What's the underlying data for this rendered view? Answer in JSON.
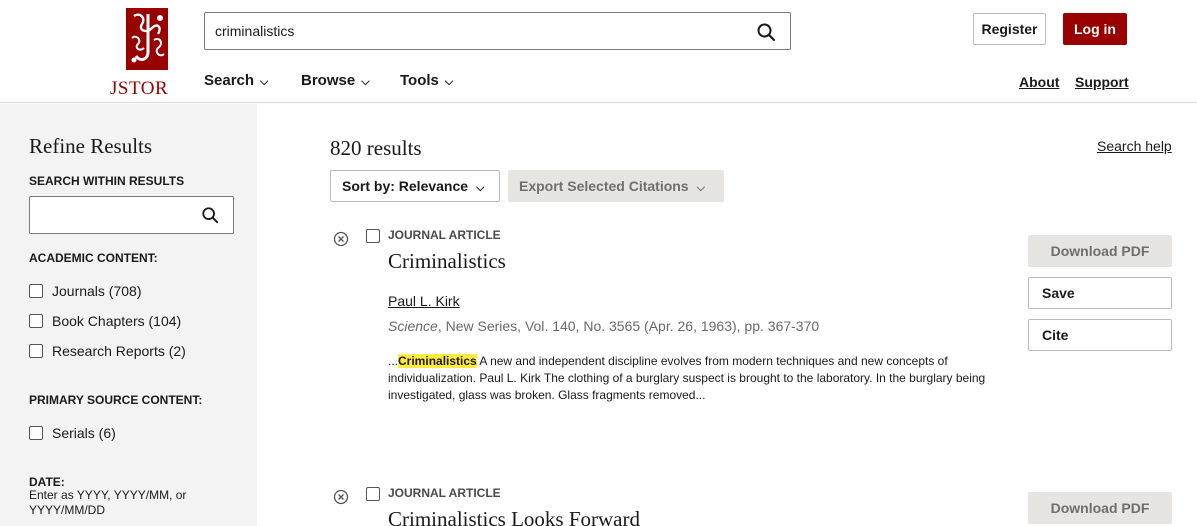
{
  "brand": {
    "name": "JSTOR",
    "color": "#990000"
  },
  "search": {
    "query": "criminalistics",
    "icon": "search-icon"
  },
  "nav": {
    "search": "Search",
    "browse": "Browse",
    "tools": "Tools"
  },
  "account": {
    "register": "Register",
    "login": "Log in"
  },
  "links": {
    "about": "About",
    "support": "Support"
  },
  "sidebar": {
    "title": "Refine Results",
    "within_label": "SEARCH WITHIN RESULTS",
    "within_value": "",
    "academic_label": "ACADEMIC CONTENT:",
    "academic_items": [
      {
        "label": "Journals (708)"
      },
      {
        "label": "Book Chapters (104)"
      },
      {
        "label": "Research Reports (2)"
      }
    ],
    "primary_label": "PRIMARY SOURCE CONTENT:",
    "primary_items": [
      {
        "label": "Serials (6)"
      }
    ],
    "date_label": "DATE:",
    "date_hint": "Enter as YYYY, YYYY/MM, or YYYY/MM/DD"
  },
  "results": {
    "count": "820 results",
    "help": "Search help",
    "sort": "Sort by: Relevance",
    "export": "Export Selected Citations",
    "items": [
      {
        "type": "JOURNAL ARTICLE",
        "title": "Criminalistics",
        "author": "Paul L. Kirk",
        "journal": "Science",
        "source_rest": ", New Series, Vol. 140, No. 3565 (Apr. 26, 1963), pp. 367-370",
        "snippet_pre": "...",
        "snippet_hl": "Criminalistics",
        "snippet_post": " A new and independent discipline evolves from modern techniques and new concepts of individualization. Paul L. Kirk The clothing of a burglary suspect is brought to the laboratory. In the burglary being investigated, glass was broken. Glass fragments removed...",
        "download": "Download PDF",
        "save": "Save",
        "cite": "Cite"
      },
      {
        "type": "JOURNAL ARTICLE",
        "title": "Criminalistics Looks Forward",
        "download": "Download PDF"
      }
    ]
  }
}
